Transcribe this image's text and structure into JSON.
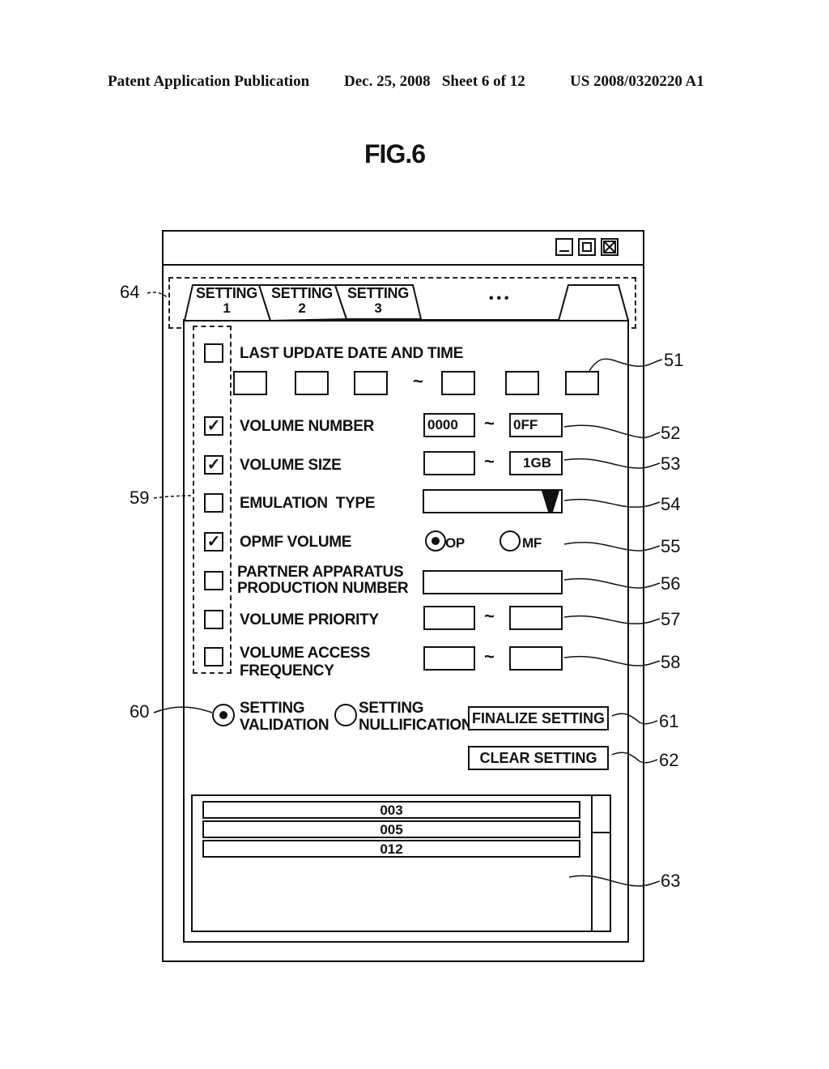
{
  "header": {
    "publication": "Patent Application Publication",
    "date_sheet": "Dec. 25, 2008   Sheet 6 of 12",
    "number": "US 2008/0320220 A1"
  },
  "figure_label": "FIG.6",
  "window": {
    "controls": [
      "minimize-icon",
      "maximize-icon",
      "close-icon"
    ]
  },
  "tabs": [
    {
      "line1": "SETTING",
      "line2": "1",
      "active": true
    },
    {
      "line1": "SETTING",
      "line2": "2",
      "active": false
    },
    {
      "line1": "SETTING",
      "line2": "3",
      "active": false
    }
  ],
  "tabs_ellipsis": "• • •",
  "conditions": {
    "last_update": {
      "label": "LAST UPDATE DATE AND TIME",
      "checked": false,
      "from": [
        "",
        "",
        ""
      ],
      "to": [
        "",
        "",
        ""
      ]
    },
    "volume_number": {
      "label": "VOLUME NUMBER",
      "checked": true,
      "from": "0000",
      "to": "0FF"
    },
    "volume_size": {
      "label": "VOLUME SIZE",
      "checked": true,
      "from": "",
      "to": "1GB"
    },
    "emulation_type": {
      "label": "EMULATION  TYPE",
      "checked": false,
      "value": ""
    },
    "opmf_volume": {
      "label": "OPMF VOLUME",
      "checked": true,
      "options": [
        "OP",
        "MF"
      ],
      "selected": "OP"
    },
    "partner_apparatus": {
      "label_line1": "PARTNER APPARATUS",
      "label_line2": "PRODUCTION NUMBER",
      "checked": false,
      "value": ""
    },
    "volume_priority": {
      "label": "VOLUME PRIORITY",
      "checked": false,
      "from": "",
      "to": ""
    },
    "volume_access_frequency": {
      "label_line1": "VOLUME ACCESS",
      "label_line2": "FREQUENCY",
      "checked": false,
      "from": "",
      "to": ""
    }
  },
  "tilde": "~",
  "check_mark": "✓",
  "setting_mode": {
    "validation": {
      "line1": "SETTING",
      "line2": "VALIDATION",
      "selected": true
    },
    "nullification": {
      "line1": "SETTING",
      "line2": "NULLIFICATION",
      "selected": false
    }
  },
  "buttons": {
    "finalize": "FINALIZE SETTING",
    "clear": "CLEAR SETTING"
  },
  "result_list": [
    "003",
    "005",
    "012"
  ],
  "reference_numerals": {
    "r51": "51",
    "r52": "52",
    "r53": "53",
    "r54": "54",
    "r55": "55",
    "r56": "56",
    "r57": "57",
    "r58": "58",
    "r59": "59",
    "r60": "60",
    "r61": "61",
    "r62": "62",
    "r63": "63",
    "r64": "64"
  }
}
